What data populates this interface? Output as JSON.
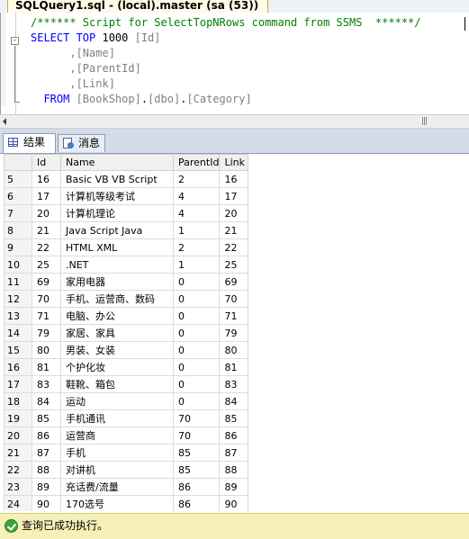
{
  "document_tab": {
    "title": "SQLQuery1.sql - (local).master (sa (53))"
  },
  "editor": {
    "lines": [
      {
        "parts": [
          {
            "cls": "cm",
            "text": "/****** Script for SelectTopNRows command from SSMS  ******/"
          }
        ]
      },
      {
        "parts": [
          {
            "cls": "kw",
            "text": "SELECT TOP "
          },
          {
            "cls": "tx",
            "text": "1000 "
          },
          {
            "cls": "br",
            "text": "[Id]"
          }
        ]
      },
      {
        "parts": [
          {
            "cls": "br",
            "text": "      ,[Name]"
          }
        ]
      },
      {
        "parts": [
          {
            "cls": "br",
            "text": "      ,[ParentId]"
          }
        ]
      },
      {
        "parts": [
          {
            "cls": "br",
            "text": "      ,[Link]"
          }
        ]
      },
      {
        "parts": [
          {
            "cls": "kw",
            "text": "  FROM "
          },
          {
            "cls": "br",
            "text": "[BookShop]"
          },
          {
            "cls": "tx",
            "text": "."
          },
          {
            "cls": "br",
            "text": "[dbo]"
          },
          {
            "cls": "tx",
            "text": "."
          },
          {
            "cls": "br",
            "text": "[Category]"
          }
        ]
      }
    ],
    "fold_marker": "-"
  },
  "result_tabs": {
    "results_label": "结果",
    "messages_label": "消息"
  },
  "grid": {
    "columns": [
      "",
      "Id",
      "Name",
      "ParentId",
      "Link"
    ],
    "rows": [
      [
        "5",
        "16",
        "Basic VB VB Script",
        "2",
        "16"
      ],
      [
        "6",
        "17",
        "计算机等级考试",
        "4",
        "17"
      ],
      [
        "7",
        "20",
        "计算机理论",
        "4",
        "20"
      ],
      [
        "8",
        "21",
        "Java Script Java",
        "1",
        "21"
      ],
      [
        "9",
        "22",
        "HTML XML",
        "2",
        "22"
      ],
      [
        "10",
        "25",
        ".NET",
        "1",
        "25"
      ],
      [
        "11",
        "69",
        "家用电器",
        "0",
        "69"
      ],
      [
        "12",
        "70",
        "手机、运营商、数码",
        "0",
        "70"
      ],
      [
        "13",
        "71",
        "电脑、办公",
        "0",
        "71"
      ],
      [
        "14",
        "79",
        "家居、家具",
        "0",
        "79"
      ],
      [
        "15",
        "80",
        "男装、女装",
        "0",
        "80"
      ],
      [
        "16",
        "81",
        "个护化妆",
        "0",
        "81"
      ],
      [
        "17",
        "83",
        "鞋靴、箱包",
        "0",
        "83"
      ],
      [
        "18",
        "84",
        "运动",
        "0",
        "84"
      ],
      [
        "19",
        "85",
        "手机通讯",
        "70",
        "85"
      ],
      [
        "20",
        "86",
        "运营商",
        "70",
        "86"
      ],
      [
        "21",
        "87",
        "手机",
        "85",
        "87"
      ],
      [
        "22",
        "88",
        "对讲机",
        "85",
        "88"
      ],
      [
        "23",
        "89",
        "充话费/流量",
        "86",
        "89"
      ],
      [
        "24",
        "90",
        "170选号",
        "86",
        "90"
      ]
    ]
  },
  "status": {
    "text": "查询已成功执行。"
  },
  "icons": {
    "results_tab_icon": "grid-icon",
    "messages_tab_icon": "message-icon",
    "status_icon": "success-check-icon"
  },
  "colors": {
    "keyword": "#0000ff",
    "comment": "#008000",
    "identifier": "#808080",
    "status_bar": "#f7f1b9"
  }
}
